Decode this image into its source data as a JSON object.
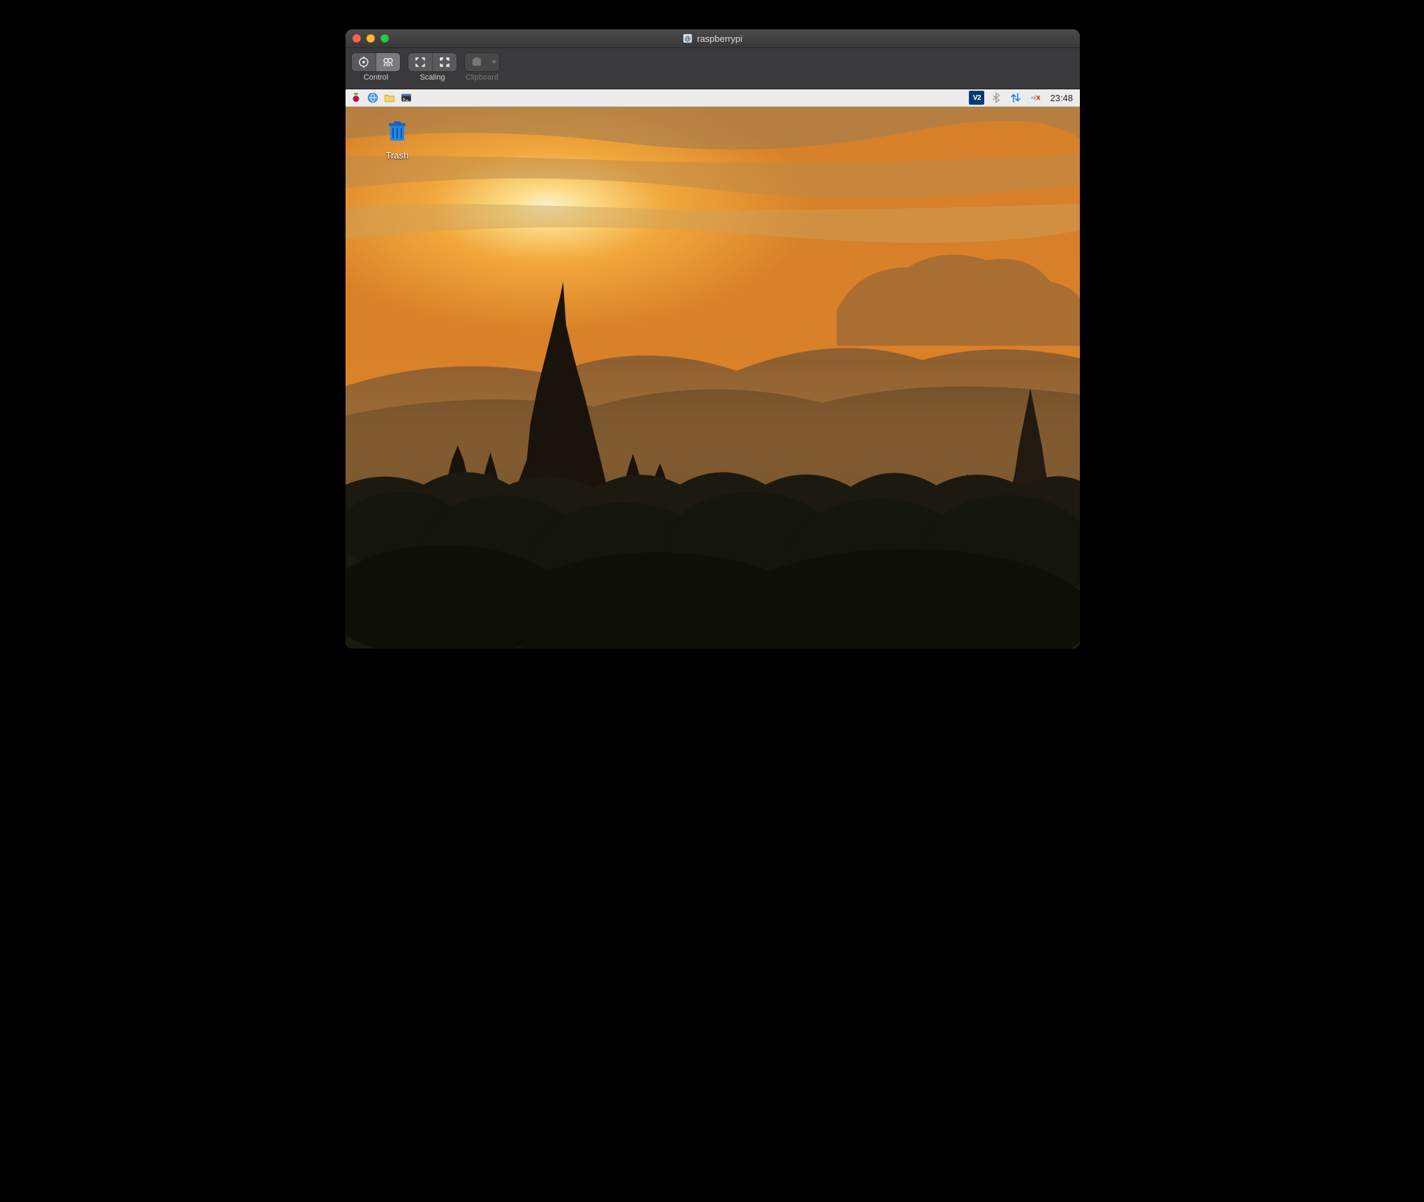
{
  "window": {
    "title": "raspberrypi",
    "toolbar": {
      "control_label": "Control",
      "scaling_label": "Scaling",
      "clipboard_label": "Clipboard"
    }
  },
  "remote": {
    "panel": {
      "vnc_badge": "V2",
      "clock": "23:48"
    },
    "desktop": {
      "trash_label": "Trash"
    }
  }
}
